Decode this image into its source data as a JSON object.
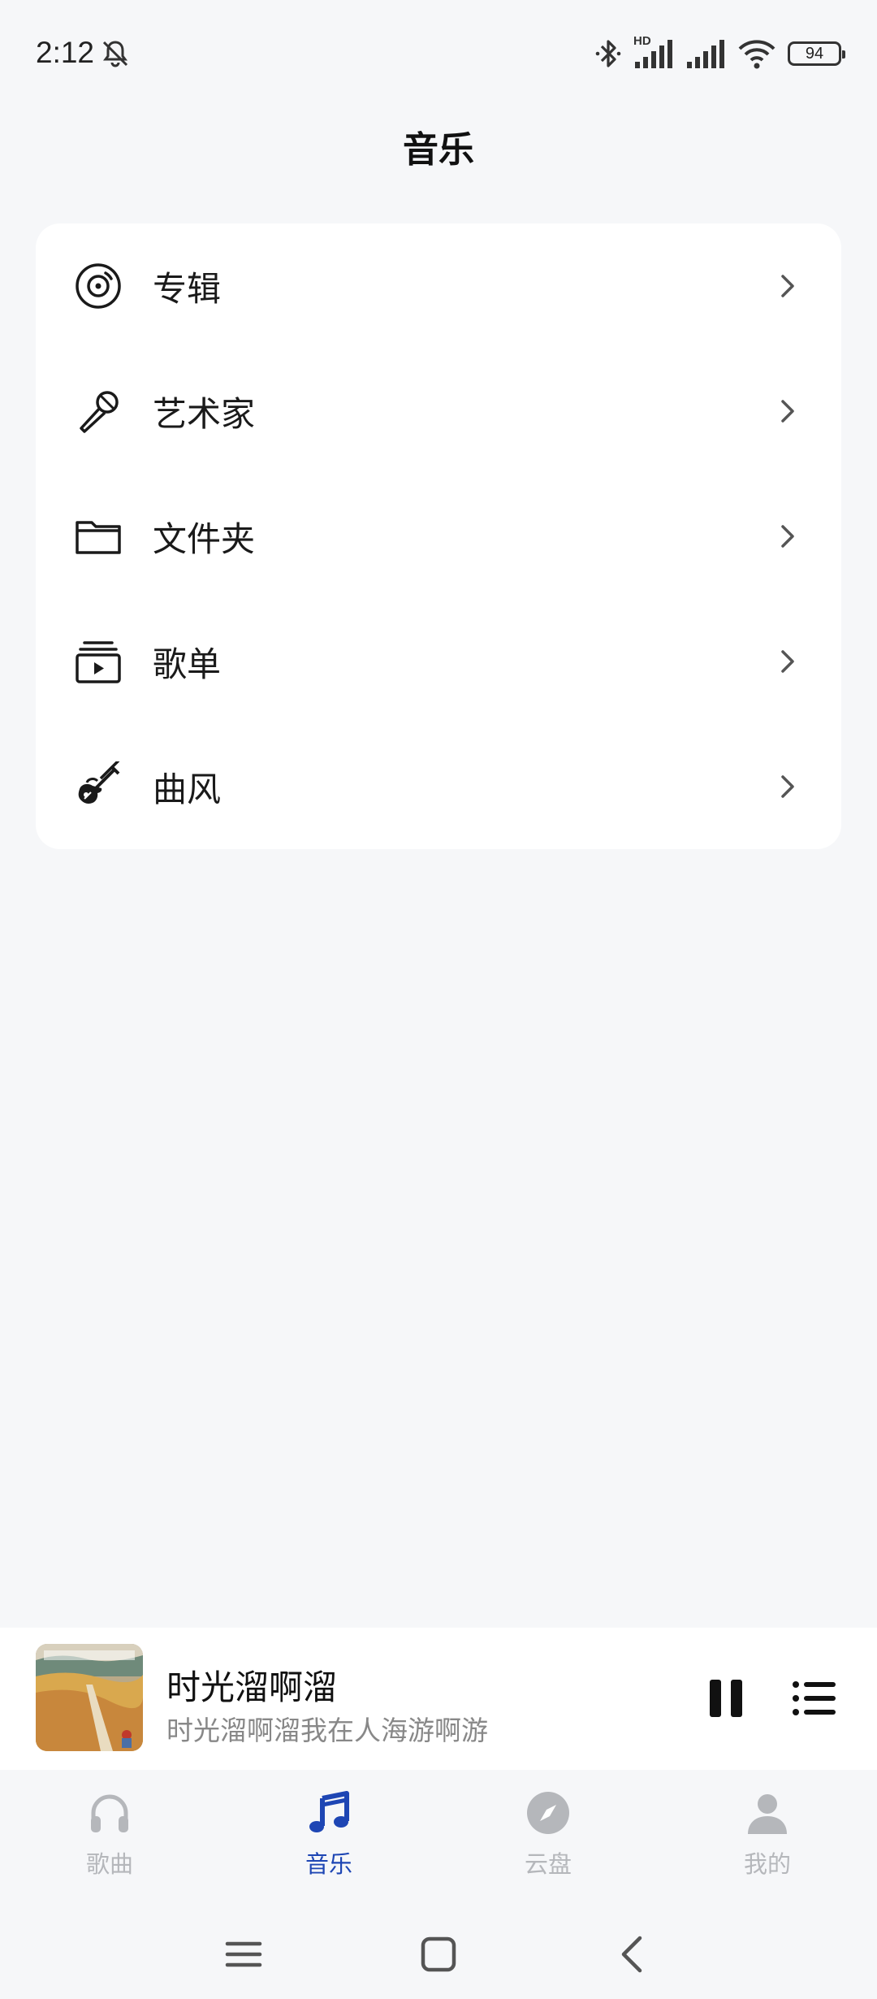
{
  "status_bar": {
    "time": "2:12",
    "battery": "94",
    "network_label": "HD"
  },
  "header": {
    "title": "音乐"
  },
  "menu": {
    "items": [
      {
        "label": "专辑",
        "icon": "disc-icon"
      },
      {
        "label": "艺术家",
        "icon": "microphone-icon"
      },
      {
        "label": "文件夹",
        "icon": "folder-icon"
      },
      {
        "label": "歌单",
        "icon": "playlist-icon"
      },
      {
        "label": "曲风",
        "icon": "guitar-icon"
      }
    ]
  },
  "player": {
    "title": "时光溜啊溜",
    "subtitle": "时光溜啊溜我在人海游啊游"
  },
  "bottom_nav": {
    "items": [
      {
        "label": "歌曲",
        "icon": "headphones-icon",
        "active": false
      },
      {
        "label": "音乐",
        "icon": "music-note-icon",
        "active": true
      },
      {
        "label": "云盘",
        "icon": "compass-icon",
        "active": false
      },
      {
        "label": "我的",
        "icon": "user-icon",
        "active": false
      }
    ]
  },
  "colors": {
    "background": "#f6f7f9",
    "accent": "#1e46b4",
    "inactive": "#b5b7bb"
  }
}
